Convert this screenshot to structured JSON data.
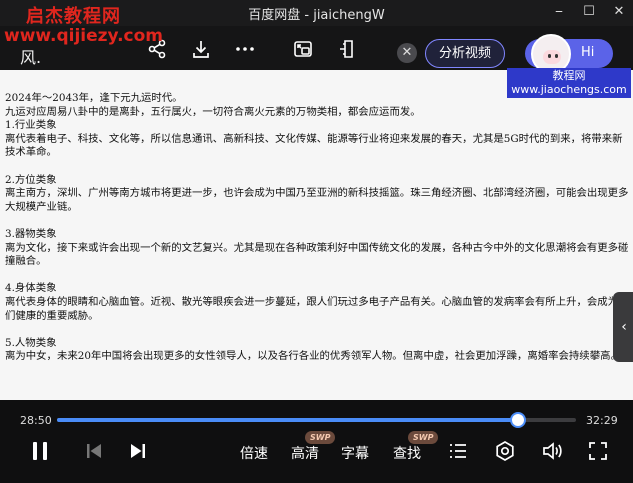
{
  "window": {
    "title": "百度网盘 - jiaichengW",
    "controls": [
      "⎯",
      "☐",
      "✕"
    ]
  },
  "watermarks": {
    "top_cn": "启杰教程网",
    "top_url": "www.qijiezy.com",
    "badge_line1": "教程网",
    "badge_line2": "www.jiaochengs.com"
  },
  "toolbar": {
    "file_name": "风.",
    "analyze_label": "分析视频",
    "hi_label": "Hi",
    "close_glyph": "✕",
    "icons": [
      "share-icon",
      "download-icon",
      "more-icon",
      "picture-in-picture-icon",
      "pin-icon"
    ]
  },
  "document": {
    "lines": [
      "2024年～2043年，逢下元九运时代。",
      "九运对应周易八卦中的是离卦，五行属火，一切符合离火元素的万物类相，都会应运而发。",
      "1.行业类象",
      "离代表着电子、科技、文化等，所以信息通讯、高新科技、文化传媒、能源等行业将迎来发展的春天，尤其是5G时代的到来，将带来新",
      "技术革命。",
      "",
      "2.方位类象",
      "离主南方，深圳、广州等南方城市将更进一步，也许会成为中国乃至亚洲的新科技摇篮。珠三角经济圈、北部湾经济圈，可能会出现更多",
      "大规模产业链。",
      "",
      "3.器物类象",
      "离为文化，接下来或许会出现一个新的文艺复兴。尤其是现在各种政策利好中国传统文化的发展，各种古今中外的文化思潮将会有更多碰",
      "撞融合。",
      "",
      "4.身体类象",
      "离代表身体的眼睛和心脑血管。近视、散光等眼疾会进一步蔓延，跟人们玩过多电子产品有关。心脑血管的发病率会有所上升，会成为人",
      "们健康的重要威胁。",
      "",
      "5.人物类象",
      "离为中女，未来20年中国将会出现更多的女性领导人，以及各行各业的优秀领军人物。但离中虚，社会更加浮躁，离婚率会持续攀高。"
    ]
  },
  "player": {
    "current_time": "28:50",
    "total_time": "32:29",
    "progress": 0.8877,
    "speed_label": "倍速",
    "quality_label": "高清",
    "subtitle_label": "字幕",
    "search_label": "查找",
    "swp_badge": "SWP",
    "side_tab_glyph": "‹",
    "accent": "#4a8cf7"
  }
}
